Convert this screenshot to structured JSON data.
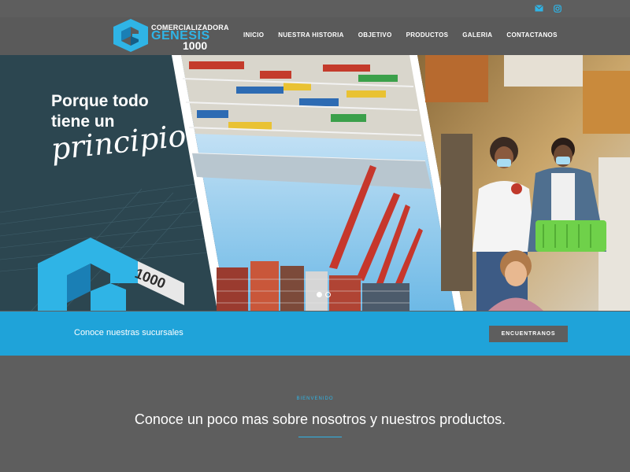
{
  "topbar": {
    "icons": [
      "email-icon",
      "instagram-icon"
    ],
    "icon_color": "#2fb4e6"
  },
  "header": {
    "logo": {
      "line1": "COMERCIALIZADORA",
      "line2": "GENESIS",
      "line3": "1000"
    },
    "nav": [
      {
        "label": "INICIO"
      },
      {
        "label": "NUESTRA HISTORIA"
      },
      {
        "label": "OBJETIVO"
      },
      {
        "label": "PRODUCTOS"
      },
      {
        "label": "GALERIA"
      },
      {
        "label": "CONTACTANOS"
      }
    ]
  },
  "hero": {
    "line1": "Porque todo",
    "line2": "tiene un",
    "line3": "principio",
    "badge": "1000",
    "slides": 2,
    "active_slide": 1
  },
  "cta": {
    "text": "Conoce nuestras sucursales",
    "button_label": "ENCUENTRANOS"
  },
  "about": {
    "kicker": "BIENVENIDO",
    "heading": "Conoce un poco mas sobre nosotros y nuestros productos."
  },
  "colors": {
    "accent": "#2fb4e6",
    "band": "#1fa3d9",
    "background": "#5e5e5e"
  }
}
